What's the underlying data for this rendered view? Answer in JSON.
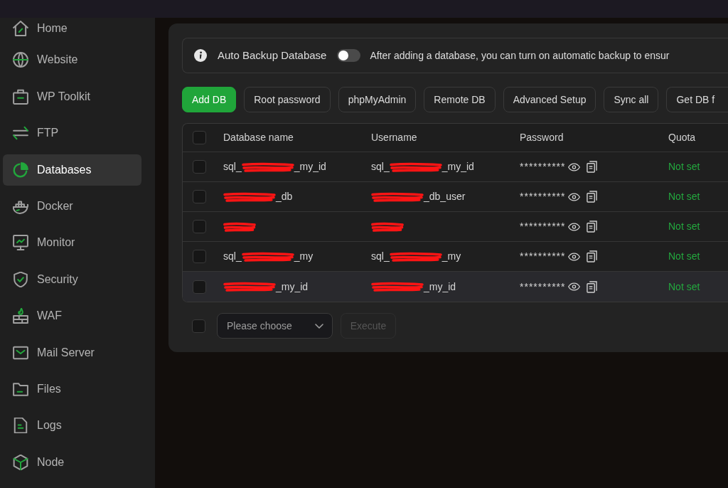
{
  "sidebar": {
    "items": [
      {
        "label": "Home",
        "selected": false
      },
      {
        "label": "Website",
        "selected": false
      },
      {
        "label": "WP Toolkit",
        "selected": false
      },
      {
        "label": "FTP",
        "selected": false
      },
      {
        "label": "Databases",
        "selected": true
      },
      {
        "label": "Docker",
        "selected": false
      },
      {
        "label": "Monitor",
        "selected": false
      },
      {
        "label": "Security",
        "selected": false
      },
      {
        "label": "WAF",
        "selected": false
      },
      {
        "label": "Mail Server",
        "selected": false
      },
      {
        "label": "Files",
        "selected": false
      },
      {
        "label": "Logs",
        "selected": false
      },
      {
        "label": "Node",
        "selected": false
      }
    ]
  },
  "auto_backup": {
    "label": "Auto Backup Database",
    "on": false,
    "description": "After adding a database, you can turn on automatic backup to ensur"
  },
  "toolbar": {
    "buttons": [
      {
        "label": "Add DB",
        "kind": "primary"
      },
      {
        "label": "Root password",
        "kind": "default"
      },
      {
        "label": "phpMyAdmin",
        "kind": "default"
      },
      {
        "label": "Remote DB",
        "kind": "default"
      },
      {
        "label": "Advanced Setup",
        "kind": "default"
      },
      {
        "label": "Sync all",
        "kind": "default"
      },
      {
        "label": "Get DB f",
        "kind": "default"
      }
    ]
  },
  "table": {
    "columns": [
      "Database name",
      "Username",
      "Password",
      "Quota"
    ],
    "all_checked": false,
    "rows": [
      {
        "checked": false,
        "highlighted": false,
        "database_name": [
          {
            "kind": "text",
            "text": "sql_"
          },
          {
            "kind": "redaction"
          },
          {
            "kind": "text",
            "text": "_my_id"
          }
        ],
        "username": [
          {
            "kind": "text",
            "text": "sql_"
          },
          {
            "kind": "redaction"
          },
          {
            "kind": "text",
            "text": "_my_id"
          }
        ],
        "password": "**********",
        "quota": "Not set"
      },
      {
        "checked": false,
        "highlighted": false,
        "database_name": [
          {
            "kind": "redaction"
          },
          {
            "kind": "text",
            "text": "_db"
          }
        ],
        "username": [
          {
            "kind": "redaction"
          },
          {
            "kind": "text",
            "text": "_db_user"
          }
        ],
        "password": "**********",
        "quota": "Not set"
      },
      {
        "checked": false,
        "highlighted": false,
        "database_name": [
          {
            "kind": "redaction"
          }
        ],
        "username": [
          {
            "kind": "redaction"
          }
        ],
        "password": "**********",
        "quota": "Not set"
      },
      {
        "checked": false,
        "highlighted": false,
        "database_name": [
          {
            "kind": "text",
            "text": "sql_"
          },
          {
            "kind": "redaction"
          },
          {
            "kind": "text",
            "text": "_my"
          }
        ],
        "username": [
          {
            "kind": "text",
            "text": "sql_"
          },
          {
            "kind": "redaction"
          },
          {
            "kind": "text",
            "text": "_my"
          }
        ],
        "password": "**********",
        "quota": "Not set"
      },
      {
        "checked": false,
        "highlighted": true,
        "database_name": [
          {
            "kind": "redaction"
          },
          {
            "kind": "text",
            "text": "_my_id"
          }
        ],
        "username": [
          {
            "kind": "redaction"
          },
          {
            "kind": "text",
            "text": "_my_id"
          }
        ],
        "password": "**********",
        "quota": "Not set"
      }
    ]
  },
  "bulk": {
    "checked": false,
    "select": {
      "placeholder": "Please choose"
    },
    "execute": {
      "label": "Execute",
      "disabled": true
    }
  }
}
